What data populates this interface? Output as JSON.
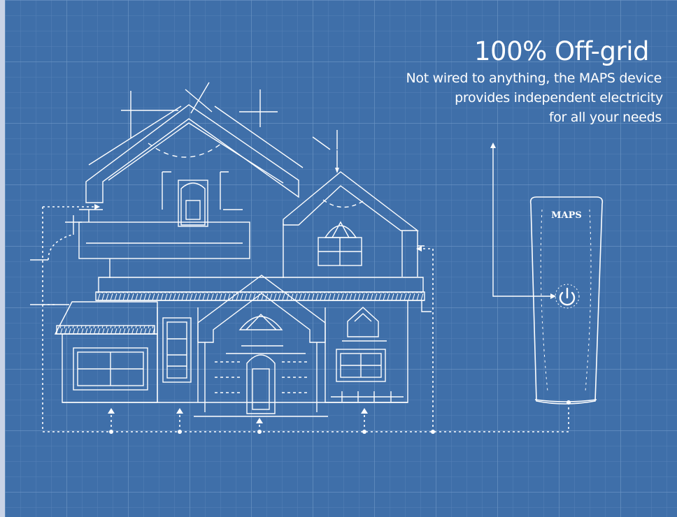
{
  "headline": "100% Off-grid",
  "description": [
    "Not wired to anything, the MAPS device",
    "provides independent electricity",
    "for all your needs"
  ],
  "device": {
    "brand": "MAPS",
    "button_icon": "power-icon"
  },
  "colors": {
    "blueprint_bg": "#3f6fa9",
    "grid_minor": "#5a86ba",
    "grid_major": "#6f97c6",
    "line": "#ffffff",
    "frame": "#c9d3e6"
  }
}
